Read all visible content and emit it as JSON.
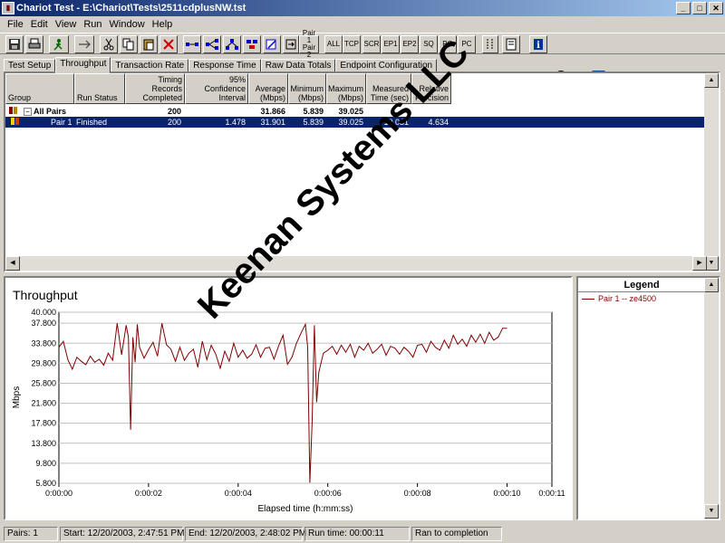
{
  "window": {
    "title": "Chariot Test - E:\\Chariot\\Tests\\2511cdplusNW.tst",
    "controls": [
      "_",
      "□",
      "✕"
    ]
  },
  "menu": [
    "File",
    "Edit",
    "View",
    "Run",
    "Window",
    "Help"
  ],
  "toolbar": {
    "text_buttons": [
      "ALL",
      "TCP",
      "SCR",
      "EP1",
      "EP2",
      "SQ",
      "PG",
      "PC"
    ],
    "pair_button": [
      "Pair 1",
      "Pair 2"
    ],
    "logo": {
      "net": "net",
      "iq": "iQ"
    }
  },
  "tabs": [
    "Test Setup",
    "Throughput",
    "Transaction Rate",
    "Response Time",
    "Raw Data Totals",
    "Endpoint Configuration"
  ],
  "active_tab": 1,
  "table": {
    "headers": [
      "Group",
      "Run Status",
      "Timing Records Completed",
      "95% Confidence Interval",
      "Average (Mbps)",
      "Minimum (Mbps)",
      "Maximum (Mbps)",
      "Measured Time (sec)",
      "Relative Precision"
    ],
    "rows": [
      {
        "group": "All Pairs",
        "toggle": "−",
        "status": "",
        "records": "200",
        "ci": "",
        "avg": "31.866",
        "min": "5.839",
        "max": "39.025",
        "time": "",
        "precision": ""
      },
      {
        "group": "Pair 1",
        "toggle": "",
        "status": "Finished",
        "records": "200",
        "ci": "1.478",
        "avg": "31.901",
        "min": "5.839",
        "max": "39.025",
        "time": "10.031",
        "precision": "4.634"
      }
    ]
  },
  "chart_data": {
    "type": "line",
    "title": "Throughput",
    "xlabel": "Elapsed time (h:mm:ss)",
    "ylabel": "Mbps",
    "ylim": [
      5.8,
      40.0
    ],
    "xlim": [
      0,
      11
    ],
    "y_ticks": [
      "40.000",
      "37.800",
      "33.800",
      "29.800",
      "25.800",
      "21.800",
      "17.800",
      "13.800",
      "9.800",
      "5.800"
    ],
    "y_tick_values": [
      40.0,
      37.8,
      33.8,
      29.8,
      25.8,
      21.8,
      17.8,
      13.8,
      9.8,
      5.8
    ],
    "x_ticks": [
      "0:00:00",
      "0:00:02",
      "0:00:04",
      "0:00:06",
      "0:00:08",
      "0:00:10",
      "0:00:11"
    ],
    "x_tick_values": [
      0,
      2,
      4,
      6,
      8,
      10,
      11
    ],
    "grid": "horizontal",
    "series": [
      {
        "name": "Pair 1 -- ze4500",
        "color": "#800000",
        "x": [
          0.0,
          0.1,
          0.2,
          0.3,
          0.4,
          0.5,
          0.6,
          0.7,
          0.8,
          0.9,
          1.0,
          1.1,
          1.2,
          1.3,
          1.4,
          1.5,
          1.55,
          1.6,
          1.65,
          1.7,
          1.75,
          1.8,
          1.9,
          2.0,
          2.1,
          2.2,
          2.3,
          2.4,
          2.5,
          2.6,
          2.7,
          2.8,
          2.9,
          3.0,
          3.1,
          3.2,
          3.3,
          3.4,
          3.5,
          3.6,
          3.7,
          3.8,
          3.9,
          4.0,
          4.1,
          4.2,
          4.3,
          4.4,
          4.5,
          4.6,
          4.7,
          4.8,
          4.9,
          5.0,
          5.1,
          5.2,
          5.3,
          5.4,
          5.5,
          5.55,
          5.6,
          5.65,
          5.7,
          5.75,
          5.8,
          5.9,
          6.0,
          6.1,
          6.2,
          6.3,
          6.4,
          6.5,
          6.6,
          6.7,
          6.8,
          6.9,
          7.0,
          7.1,
          7.2,
          7.3,
          7.4,
          7.5,
          7.6,
          7.7,
          7.8,
          7.9,
          8.0,
          8.1,
          8.2,
          8.3,
          8.4,
          8.5,
          8.6,
          8.7,
          8.8,
          8.9,
          9.0,
          9.1,
          9.2,
          9.3,
          9.4,
          9.5,
          9.6,
          9.7,
          9.8,
          9.9,
          10.0
        ],
        "values": [
          33.0,
          34.2,
          30.5,
          28.6,
          31.0,
          30.2,
          29.5,
          31.2,
          30.0,
          30.6,
          29.4,
          31.8,
          30.4,
          37.8,
          31.5,
          37.4,
          35.0,
          16.5,
          35.0,
          30.0,
          37.6,
          33.0,
          30.8,
          32.5,
          34.0,
          31.2,
          37.8,
          33.5,
          32.6,
          30.2,
          33.0,
          30.4,
          31.8,
          32.6,
          29.0,
          34.2,
          30.5,
          33.4,
          31.6,
          28.8,
          32.2,
          30.2,
          33.8,
          31.0,
          32.4,
          30.8,
          31.6,
          33.5,
          31.0,
          32.8,
          33.0,
          30.6,
          33.2,
          35.4,
          29.6,
          31.0,
          33.8,
          35.8,
          37.6,
          33.0,
          5.9,
          18.0,
          37.4,
          22.0,
          28.0,
          31.8,
          32.4,
          33.2,
          31.6,
          33.4,
          32.0,
          33.6,
          31.0,
          33.2,
          32.4,
          33.8,
          31.8,
          32.6,
          33.6,
          31.4,
          33.2,
          32.8,
          31.6,
          33.0,
          32.2,
          31.0,
          33.4,
          33.6,
          32.0,
          34.2,
          33.0,
          32.4,
          34.4,
          32.8,
          35.4,
          33.6,
          34.6,
          33.2,
          35.4,
          34.0,
          35.6,
          33.8,
          36.0,
          34.4,
          35.0,
          36.8,
          36.8
        ]
      }
    ]
  },
  "legend": {
    "title": "Legend"
  },
  "watermark": "Keenan Systems LLC",
  "status": [
    "Pairs: 1",
    "Start: 12/20/2003, 2:47:51 PM",
    "End: 12/20/2003, 2:48:02 PM",
    "Run time: 00:00:11",
    "Ran to completion"
  ]
}
